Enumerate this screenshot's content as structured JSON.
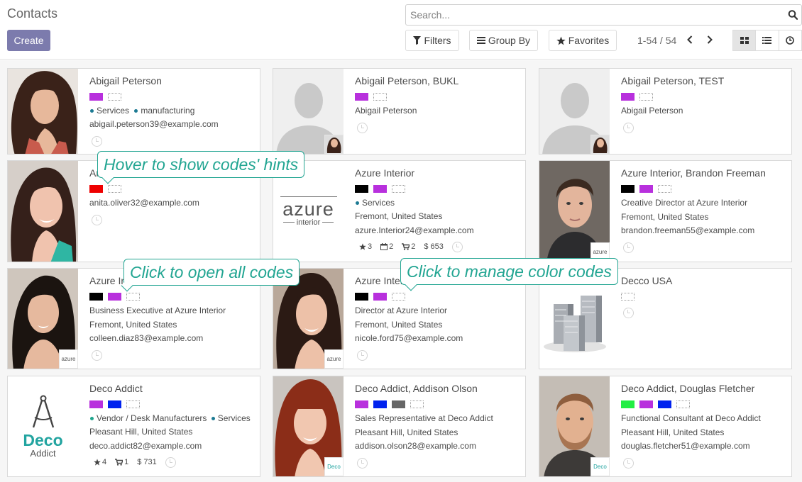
{
  "header": {
    "title": "Contacts",
    "create_label": "Create",
    "search_placeholder": "Search...",
    "filters_label": "Filters",
    "groupby_label": "Group By",
    "favorites_label": "Favorites",
    "pager": "1-54 / 54"
  },
  "colors": {
    "accent": "#7c7bad",
    "hint": "#22a592",
    "category_dot": "#1c7a93"
  },
  "cards": [
    {
      "name": "Abigail Peterson",
      "tags": [
        "#b830dd",
        "empty"
      ],
      "categories": [
        "Services",
        "manufacturing"
      ],
      "lines": [
        "abigail.peterson39@example.com"
      ],
      "image": "photo-curly"
    },
    {
      "name": "Abigail Peterson, BUKL",
      "tags": [
        "#b830dd",
        "empty"
      ],
      "lines": [
        "Abigail Peterson"
      ],
      "image": "placeholder"
    },
    {
      "name": "Abigail Peterson, TEST",
      "tags": [
        "#b830dd",
        "empty"
      ],
      "lines": [
        "Abigail Peterson"
      ],
      "image": "placeholder"
    },
    {
      "name": "Anita Oliver",
      "tags": [
        "#ee0000",
        "empty"
      ],
      "lines": [
        "anita.oliver32@example.com"
      ],
      "image": "photo-dark-hair"
    },
    {
      "name": "Azure Interior",
      "tags": [
        "#000000",
        "#b830dd",
        "empty"
      ],
      "categories": [
        "Services"
      ],
      "lines": [
        "Fremont, United States",
        "azure.Interior24@example.com"
      ],
      "stats": [
        "3",
        "2",
        "2",
        "$ 653"
      ],
      "image": "azure-logo",
      "logo_word": "azure",
      "logo_sub": "interior"
    },
    {
      "name": "Azure Interior, Brandon Freeman",
      "tags": [
        "#000000",
        "#b830dd",
        "empty"
      ],
      "lines": [
        "Creative Director at Azure Interior",
        "Fremont, United States",
        "brandon.freeman55@example.com"
      ],
      "image": "photo-man"
    },
    {
      "name": "Azure Interior, Colleen Diaz",
      "tags": [
        "#000000",
        "#b830dd",
        "empty"
      ],
      "lines": [
        "Business Executive at Azure Interior",
        "Fremont, United States",
        "colleen.diaz83@example.com"
      ],
      "image": "photo-colleen"
    },
    {
      "name": "Azure Interior, Nicole Ford",
      "tags": [
        "#000000",
        "#b830dd",
        "empty"
      ],
      "lines": [
        "Director at Azure Interior",
        "Fremont, United States",
        "nicole.ford75@example.com"
      ],
      "image": "photo-nicole"
    },
    {
      "name": "Decco USA",
      "tags": [
        "empty"
      ],
      "lines": [],
      "image": "building"
    },
    {
      "name": "Deco Addict",
      "tags": [
        "#b830dd",
        "#0022ee",
        "empty"
      ],
      "categories": [
        "Vendor / Desk Manufacturers",
        "Services"
      ],
      "lines": [
        "Pleasant Hill, United States",
        "deco.addict82@example.com"
      ],
      "stats": [
        "4",
        "1",
        "$ 731"
      ],
      "image": "deco-logo",
      "logo_word": "Deco",
      "logo_sub": "Addict"
    },
    {
      "name": "Deco Addict, Addison Olson",
      "tags": [
        "#b830dd",
        "#0022ee",
        "#666666",
        "empty"
      ],
      "lines": [
        "Sales Representative at Deco Addict",
        "Pleasant Hill, United States",
        "addison.olson28@example.com"
      ],
      "image": "photo-addison"
    },
    {
      "name": "Deco Addict, Douglas Fletcher",
      "tags": [
        "#22ee44",
        "#b830dd",
        "#0022ee",
        "empty"
      ],
      "lines": [
        "Functional Consultant at Deco Addict",
        "Pleasant Hill, United States",
        "douglas.fletcher51@example.com"
      ],
      "image": "photo-douglas"
    }
  ],
  "hints": [
    {
      "text": "Hover to show codes' hints"
    },
    {
      "text": "Click to open all codes"
    },
    {
      "text": "Click to manage color codes"
    }
  ],
  "badges": {
    "azure_word": "azure",
    "deco_word": "Deco"
  }
}
